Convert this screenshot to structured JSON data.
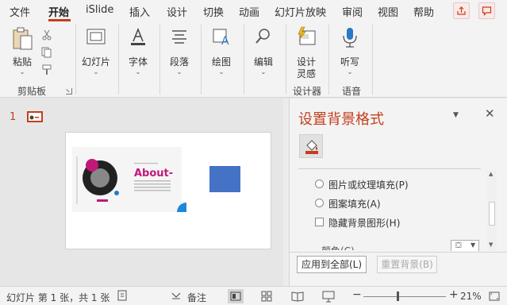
{
  "menubar": {
    "tabs": [
      {
        "label": "文件",
        "active": false
      },
      {
        "label": "开始",
        "active": true
      },
      {
        "label": "iSlide",
        "active": false
      },
      {
        "label": "插入",
        "active": false
      },
      {
        "label": "设计",
        "active": false
      },
      {
        "label": "切换",
        "active": false
      },
      {
        "label": "动画",
        "active": false
      },
      {
        "label": "幻灯片放映",
        "active": false
      },
      {
        "label": "审阅",
        "active": false
      },
      {
        "label": "视图",
        "active": false
      },
      {
        "label": "帮助",
        "active": false
      }
    ],
    "share_icon": "share-icon",
    "comment_icon": "comment-icon"
  },
  "ribbon": {
    "paste": {
      "label": "粘贴",
      "icon": "paste-icon"
    },
    "clipboard_group": "剪贴板",
    "slides": {
      "label": "幻灯片",
      "icon": "slides-icon"
    },
    "font": {
      "label": "字体",
      "icon": "font-icon"
    },
    "paragraph": {
      "label": "段落",
      "icon": "paragraph-icon"
    },
    "drawing": {
      "label": "绘图",
      "icon": "shapes-icon"
    },
    "editing": {
      "label": "编辑",
      "icon": "search-icon"
    },
    "designer": {
      "label_line1": "设计",
      "label_line2": "灵感",
      "icon": "designer-icon"
    },
    "designer_group": "设计器",
    "dictate": {
      "label": "听写",
      "icon": "microphone-icon"
    },
    "voice_group": "语音"
  },
  "thumbnails": {
    "slide_number": "1"
  },
  "slide": {
    "title": "About-"
  },
  "format_pane": {
    "title": "设置背景格式",
    "fill_tab_icon": "paint-bucket-icon",
    "options": [
      {
        "label": "图片或纹理填充(P)",
        "type": "radio"
      },
      {
        "label": "图案填充(A)",
        "type": "radio"
      },
      {
        "label": "隐藏背景图形(H)",
        "type": "checkbox"
      }
    ],
    "cut_label": "颜色(C)",
    "apply_all": "应用到全部(L)",
    "reset_bg": "重置背景(B)"
  },
  "statusbar": {
    "slide_info": "幻灯片 第 1 张，共 1 张",
    "notes": "备注",
    "zoom": "21%",
    "zoom_fraction": 0.21,
    "accent": "#c43e1c"
  }
}
